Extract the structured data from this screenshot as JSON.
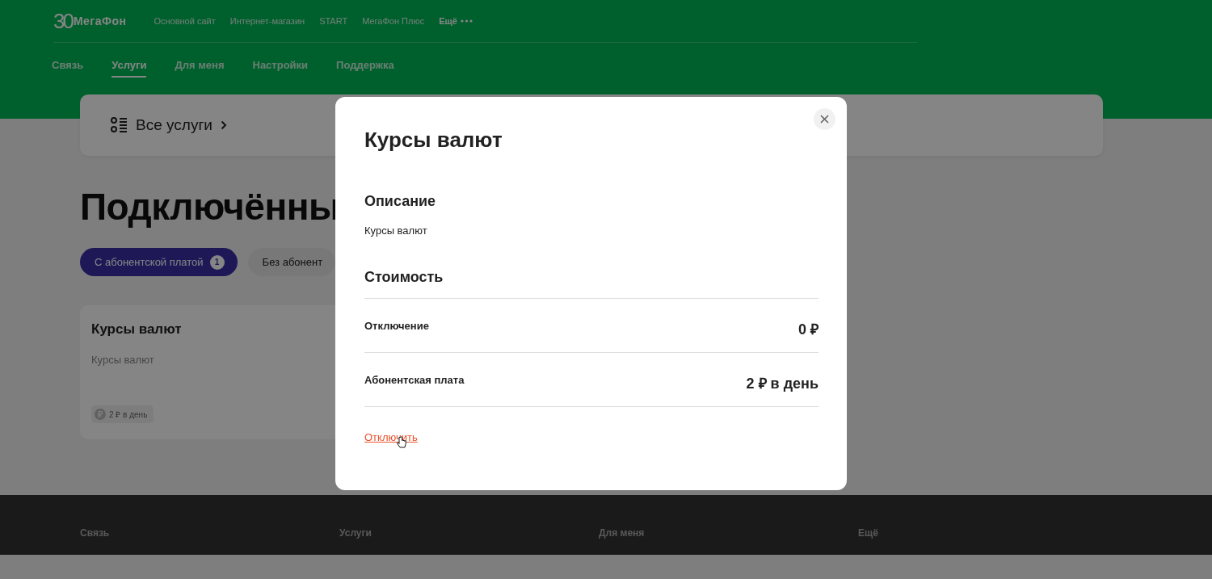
{
  "logo": {
    "badge": "30",
    "name": "МегаФон"
  },
  "top_links": [
    {
      "label": "Основной сайт"
    },
    {
      "label": "Интернет-магазин"
    },
    {
      "label": "START"
    },
    {
      "label": "МегаФон Плюс"
    },
    {
      "label": "Ещё",
      "kind": "more"
    }
  ],
  "nav": [
    {
      "label": "Связь",
      "selected": false
    },
    {
      "label": "Услуги",
      "selected": true
    },
    {
      "label": "Для меня",
      "selected": false
    },
    {
      "label": "Настройки",
      "selected": false
    },
    {
      "label": "Поддержка",
      "selected": false
    }
  ],
  "all_services": {
    "label": "Все услуги"
  },
  "heading": "Подключённы",
  "filters": [
    {
      "label": "С абонентской платой",
      "count": "1",
      "selected": true
    },
    {
      "label": "Без абонент",
      "selected": false
    }
  ],
  "service_card": {
    "title": "Курсы валют",
    "description": "Курсы валют",
    "price": "2 ₽ в день"
  },
  "modal": {
    "title": "Курсы валют",
    "sections": [
      {
        "heading": "Описание",
        "text": "Курсы валют"
      },
      {
        "heading": "Стоимость"
      }
    ],
    "rows": [
      {
        "label": "Отключение",
        "value": "0 ₽"
      },
      {
        "label": "Абонентская плата",
        "value": "2 ₽ в день"
      }
    ],
    "action": "Отключить"
  },
  "footer": [
    {
      "label": "Связь"
    },
    {
      "label": "Услуги"
    },
    {
      "label": "Для меня"
    },
    {
      "label": "Ещё"
    }
  ]
}
